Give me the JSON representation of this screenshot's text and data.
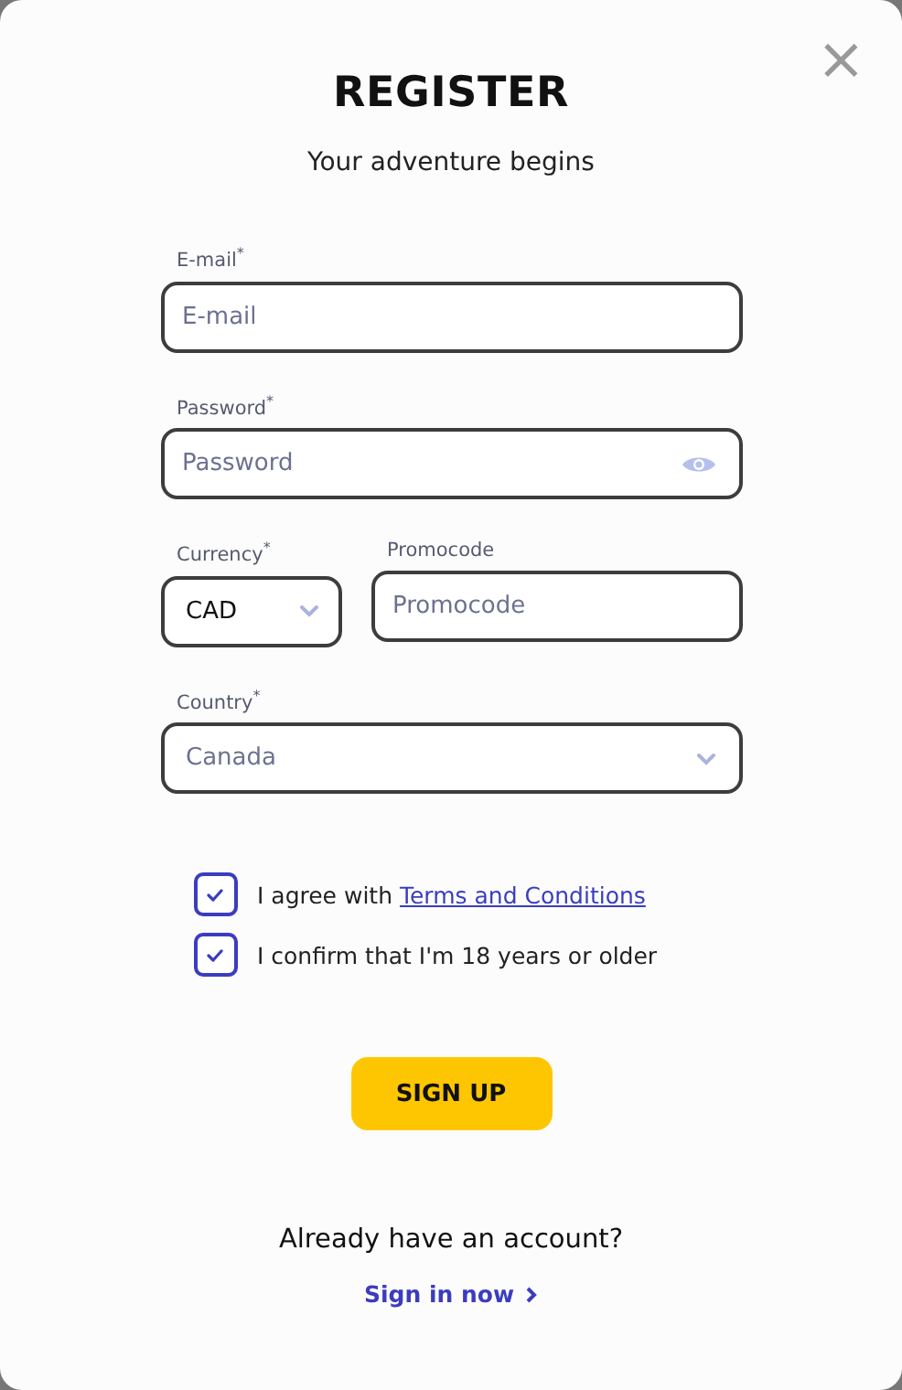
{
  "dialog": {
    "title": "REGISTER",
    "subtitle": "Your adventure begins",
    "close": "×"
  },
  "fields": {
    "email": {
      "label": "E-mail$^{*}$",
      "placeholder": "E-mail"
    },
    "password": {
      "label": "Password$^{*}$",
      "placeholder": "Password"
    },
    "currency": {
      "label": "Currency$^{*}$",
      "value": "CAD"
    },
    "promocode": {
      "label": "Promocode",
      "placeholder": "Promocode"
    },
    "country": {
      "label": "Country$^{*}$",
      "value": "Canada"
    }
  },
  "checkboxes": [
    {
      "text": "I agree with",
      "link": "Terms and Conditions",
      "checked": true
    },
    {
      "text": "I confirm that I'm 18 years or older",
      "checked": true
    }
  ],
  "submit": "SIGN UP",
  "footer": {
    "question": "Already have an account?",
    "link": "Sign in now"
  }
}
